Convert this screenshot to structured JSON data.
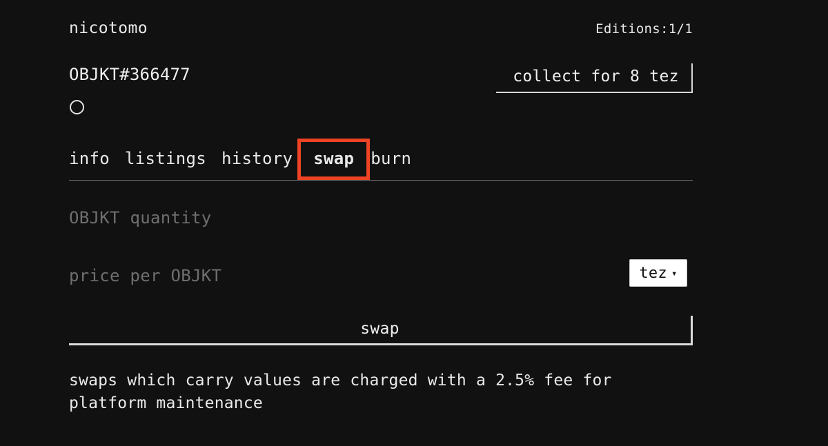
{
  "theme": {
    "background": "#111111",
    "text": "#e9e9e9",
    "muted_text": "#6f6f6f",
    "rule": "#6a6a6a",
    "highlight": "#ee4324",
    "select_bg": "#ffffff",
    "select_text": "#111111"
  },
  "header": {
    "creator": "nicotomo",
    "editions": "Editions:1/1"
  },
  "token": {
    "id_label": "OBJKT#366477",
    "collect_label": "collect for 8 tez",
    "status_icon": "loading-ring-icon"
  },
  "tabs": [
    {
      "label": "info",
      "name": "tab-info",
      "highlighted": false
    },
    {
      "label": "listings",
      "name": "tab-listings",
      "highlighted": false
    },
    {
      "label": "history",
      "name": "tab-history",
      "highlighted": false
    },
    {
      "label": "swap",
      "name": "tab-swap",
      "highlighted": true
    },
    {
      "label": "burn",
      "name": "tab-burn",
      "highlighted": false
    }
  ],
  "form": {
    "quantity": {
      "placeholder": "OBJKT quantity",
      "value": ""
    },
    "price": {
      "placeholder": "price per OBJKT",
      "value": ""
    },
    "currency": {
      "selected": "tez",
      "options": [
        "tez"
      ],
      "chevron": "⌄",
      "chevron_icon": "chevron-down-icon"
    },
    "submit_label": "swap"
  },
  "footer": {
    "fee_note": "swaps which carry values are charged with a 2.5% fee for platform maintenance"
  }
}
